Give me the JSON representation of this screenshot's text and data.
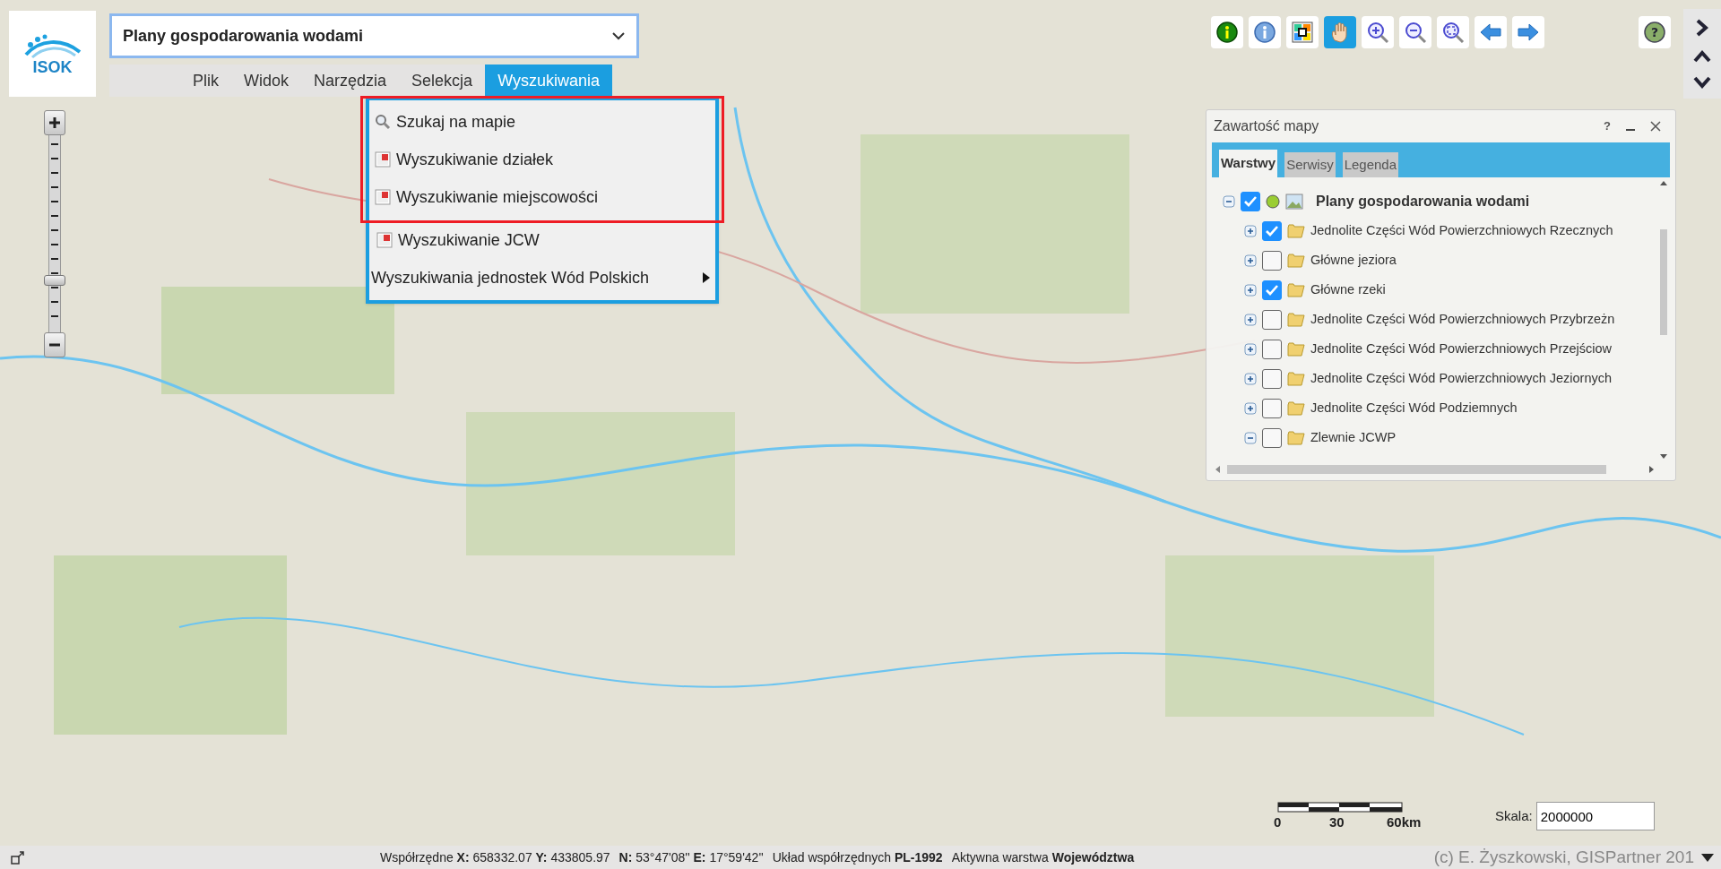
{
  "logo": {
    "text": "ISOK"
  },
  "layer_selector": {
    "value": "Plany gospodarowania wodami"
  },
  "menu": [
    {
      "label": "Plik",
      "selected": false
    },
    {
      "label": "Widok",
      "selected": false
    },
    {
      "label": "Narzędzia",
      "selected": false
    },
    {
      "label": "Selekcja",
      "selected": false
    },
    {
      "label": "Wyszukiwania",
      "selected": true
    }
  ],
  "dropdown": {
    "items": [
      {
        "kind": "search",
        "label": "Szukaj na mapie",
        "highlighted": true
      },
      {
        "kind": "form",
        "label": "Wyszukiwanie działek",
        "highlighted": true
      },
      {
        "kind": "form",
        "label": "Wyszukiwanie miejscowości",
        "highlighted": true
      },
      {
        "kind": "form",
        "label": "Wyszukiwanie JCW",
        "highlighted": false
      },
      {
        "kind": "submenu",
        "label": "Wyszukiwania jednostek Wód Polskich",
        "highlighted": false
      }
    ]
  },
  "zoom_slider": {
    "level": 0.25
  },
  "toolbar": [
    {
      "kind": "info-green",
      "selected": false
    },
    {
      "kind": "info-blue",
      "selected": false
    },
    {
      "kind": "select",
      "selected": false
    },
    {
      "kind": "pan",
      "selected": true
    },
    {
      "kind": "zoom-in",
      "selected": false
    },
    {
      "kind": "zoom-out",
      "selected": false
    },
    {
      "kind": "zoom-extent",
      "selected": false
    },
    {
      "kind": "back",
      "selected": false
    },
    {
      "kind": "forward",
      "selected": false
    }
  ],
  "help_button": {
    "label": "?"
  },
  "layer_panel": {
    "title": "Zawartość mapy",
    "header_buttons": [
      "?"
    ],
    "tabs": [
      {
        "label": "Warstwy",
        "selected": true
      },
      {
        "label": "Serwisy",
        "selected": false
      },
      {
        "label": "Legenda",
        "selected": false
      }
    ],
    "tree": [
      {
        "label": "Plany gospodarowania wodami",
        "checked": true,
        "expanded": true,
        "children": [
          {
            "label": "Jednolite Części Wód Powierzchniowych Rzecznych",
            "checked": true,
            "expanded": false
          },
          {
            "label": "Główne jeziora",
            "checked": false,
            "expanded": false
          },
          {
            "label": "Główne rzeki",
            "checked": true,
            "expanded": false
          },
          {
            "label": "Jednolite Części Wód Powierzchniowych Przybrzeżn",
            "checked": false,
            "expanded": false
          },
          {
            "label": "Jednolite Części Wód Powierzchniowych Przejściow",
            "checked": false,
            "expanded": false
          },
          {
            "label": "Jednolite Części Wód Powierzchniowych Jeziornych",
            "checked": false,
            "expanded": false
          },
          {
            "label": "Jednolite Części Wód Podziemnych",
            "checked": false,
            "expanded": false
          },
          {
            "label": "Zlewnie JCWP",
            "checked": false,
            "expanded": true
          }
        ]
      }
    ]
  },
  "scale_bar": {
    "labels": [
      "0",
      "30",
      "60km"
    ]
  },
  "scale_field": {
    "label": "Skala:",
    "value": "2000000"
  },
  "status_bar": {
    "items": [
      "Współrzędne **X:** 658332.07 **Y:** 433805.97",
      "**N:** 53°47'08'' **E:** 17°59'42''",
      "Układ współrzędnych **PL-1992**",
      "Aktywna warstwa **Województwa**"
    ],
    "copyright": "(c) E. Żyszkowski, GISPartner 201"
  }
}
